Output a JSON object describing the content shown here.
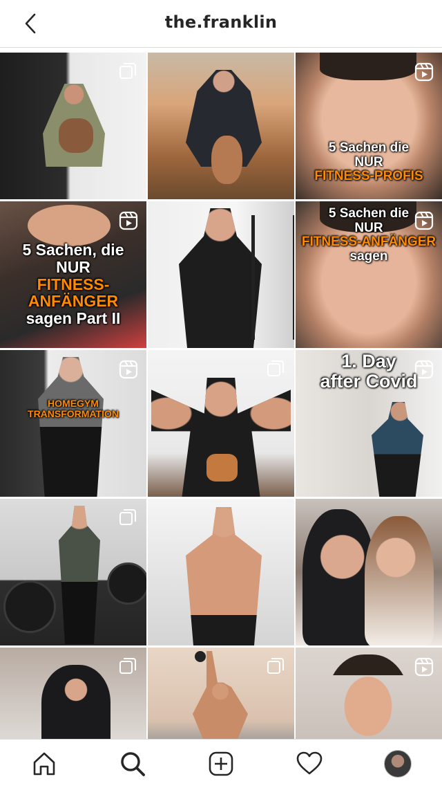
{
  "header": {
    "title": "the.franklin",
    "back_icon": "chevron-left-icon"
  },
  "overlays": {
    "t3": [
      "5 Sachen die",
      "NUR",
      "FITNESS-PROFIS"
    ],
    "t4": [
      "5 Sachen, die",
      "NUR",
      "FITNESS-ANFÄNGER",
      "sagen Part II"
    ],
    "t6": [
      "5 Sachen die",
      "NUR",
      "FITNESS-ANFÄNGER",
      "sagen"
    ],
    "t7": [
      "HOMEGYM",
      "TRANSFORMATION"
    ],
    "t9": [
      "1. Day",
      "after Covid"
    ]
  },
  "nav": {
    "items": [
      "home-icon",
      "search-icon",
      "new-post-icon",
      "activity-icon",
      "profile-avatar"
    ]
  },
  "colors": {
    "accent_orange": "#ff8a00",
    "text": "#262626",
    "border": "#dbdbdb"
  }
}
